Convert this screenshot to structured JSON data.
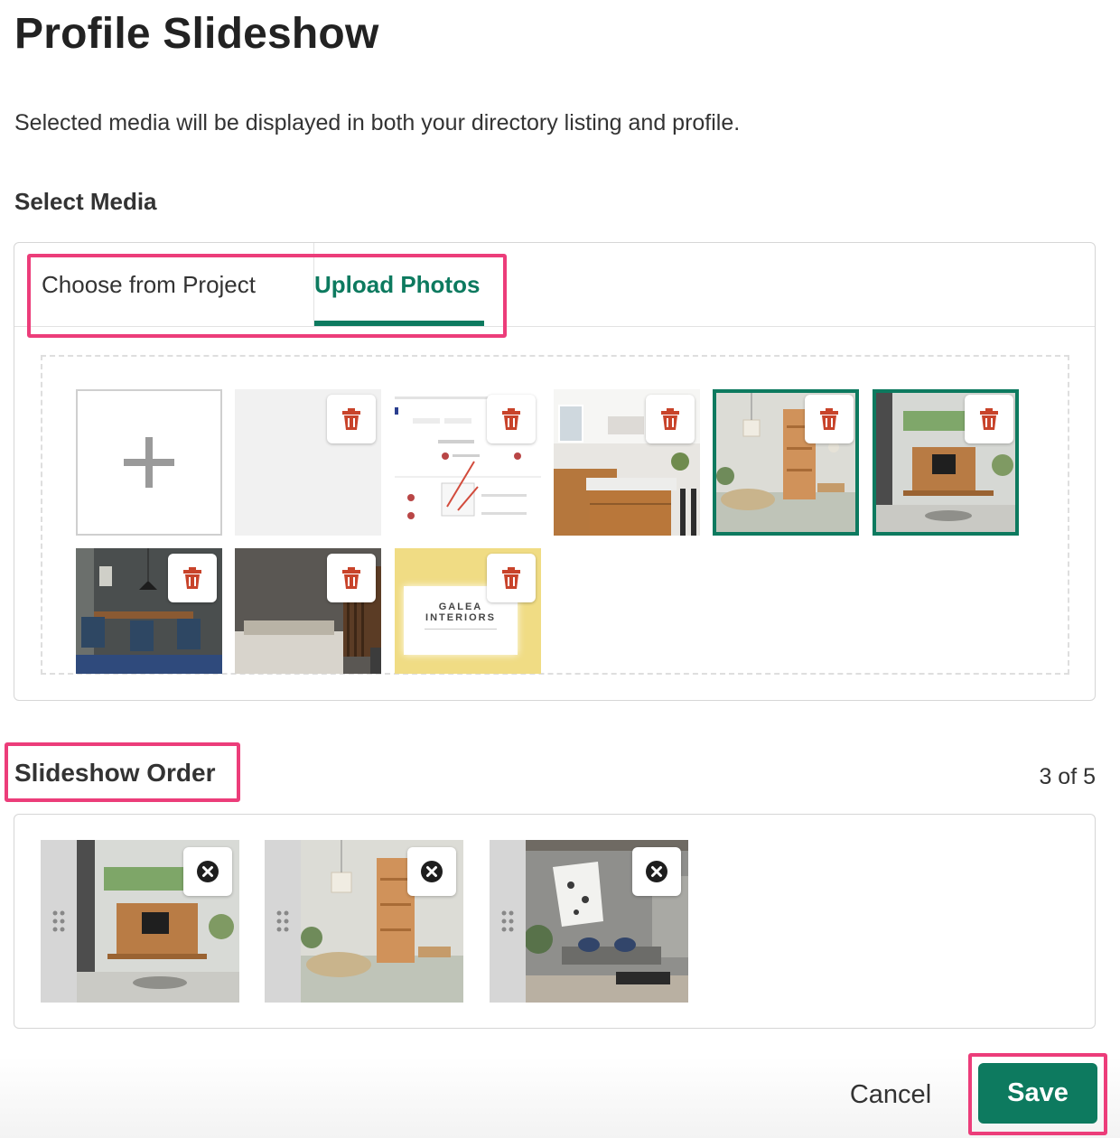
{
  "page": {
    "title": "Profile Slideshow",
    "description": "Selected media will be displayed in both your directory listing and profile."
  },
  "select_media": {
    "label": "Select Media",
    "tabs": [
      {
        "label": "Choose from Project",
        "active": false
      },
      {
        "label": "Upload Photos",
        "active": true
      }
    ],
    "add_icon": "plus-icon",
    "delete_icon": "trash-icon",
    "photos": [
      {
        "id": "blank",
        "selected": false
      },
      {
        "id": "screenshot",
        "selected": false
      },
      {
        "id": "kitchen",
        "selected": false
      },
      {
        "id": "living-shelves",
        "selected": true
      },
      {
        "id": "living-tv",
        "selected": true
      },
      {
        "id": "dining",
        "selected": false
      },
      {
        "id": "bedroom",
        "selected": false
      },
      {
        "id": "galea-logo",
        "selected": false,
        "logo_lines": [
          "GALEA",
          "INTERIORS"
        ]
      }
    ]
  },
  "slideshow_order": {
    "title": "Slideshow Order",
    "count_text": "3 of 5",
    "drag_icon": "drag-handle-icon",
    "remove_icon": "close-circle-icon",
    "items": [
      "living-tv",
      "living-shelves",
      "living-kimono"
    ]
  },
  "footer": {
    "cancel_label": "Cancel",
    "save_label": "Save"
  },
  "colors": {
    "accent": "#0d7a5f",
    "highlight": "#ec3d7a",
    "delete": "#c8432a"
  }
}
